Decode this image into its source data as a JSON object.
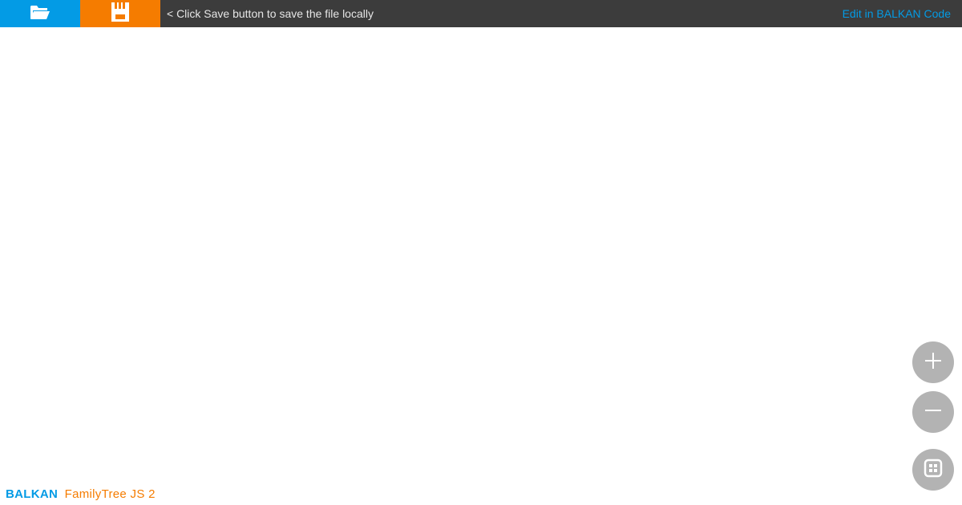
{
  "toolbar": {
    "open_icon": "folder-open-icon",
    "save_icon": "floppy-disk-icon",
    "hint": "< Click Save button to save the file locally",
    "edit_link": "Edit in BALKAN Code"
  },
  "controls": {
    "zoom_in_icon": "plus-icon",
    "zoom_out_icon": "minus-icon",
    "fit_icon": "fit-to-screen-icon"
  },
  "brand": {
    "company": "BALKAN",
    "product": "FamilyTree JS 2"
  },
  "colors": {
    "toolbar_bg": "#3c3c3c",
    "open_button": "#039be5",
    "save_button": "#f57c00",
    "link": "#039be5",
    "control_bg": "#b3b3b3"
  }
}
